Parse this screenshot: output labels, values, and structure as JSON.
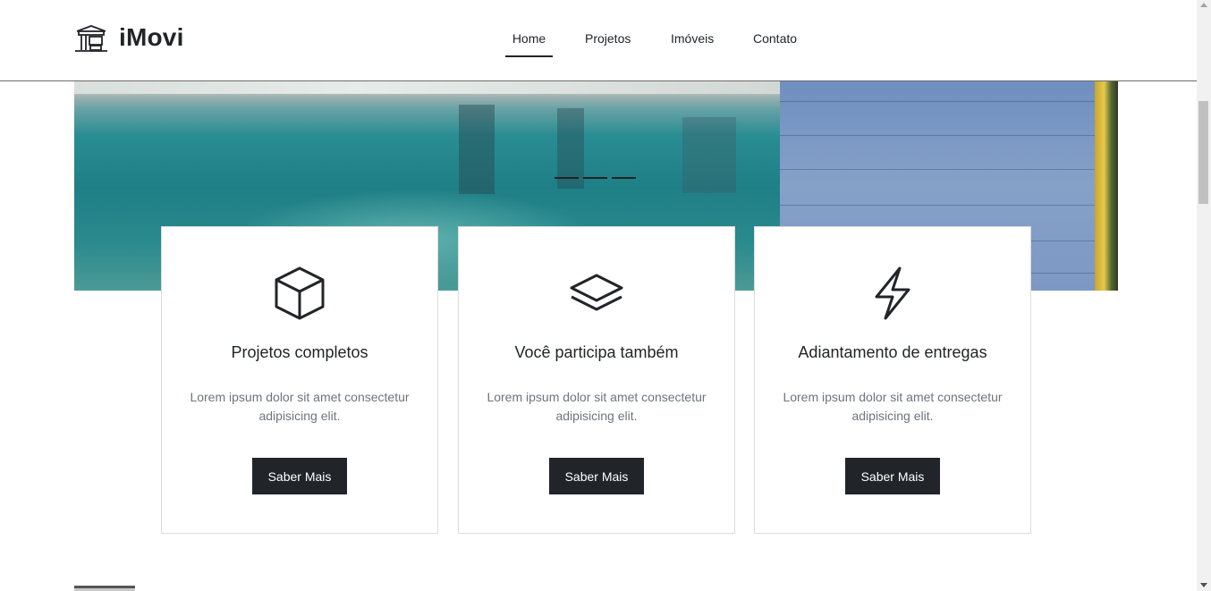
{
  "brand": {
    "name": "iMovi",
    "logo_icon": "building-icon"
  },
  "nav": {
    "items": [
      {
        "label": "Home",
        "active": true
      },
      {
        "label": "Projetos",
        "active": false
      },
      {
        "label": "Imóveis",
        "active": false
      },
      {
        "label": "Contato",
        "active": false
      }
    ]
  },
  "hero": {
    "carousel_slides": 3,
    "active_slide": 1
  },
  "cards": [
    {
      "icon": "box-icon",
      "title": "Projetos completos",
      "text": "Lorem ipsum dolor sit amet consectetur adipisicing elit.",
      "button": "Saber Mais"
    },
    {
      "icon": "layers-icon",
      "title": "Você participa também",
      "text": "Lorem ipsum dolor sit amet consectetur adipisicing elit.",
      "button": "Saber Mais"
    },
    {
      "icon": "lightning-icon",
      "title": "Adiantamento de entregas",
      "text": "Lorem ipsum dolor sit amet consectetur adipisicing elit.",
      "button": "Saber Mais"
    }
  ],
  "colors": {
    "primary_dark": "#212529",
    "muted_text": "#6c757d",
    "card_border": "#dcdcdc"
  }
}
